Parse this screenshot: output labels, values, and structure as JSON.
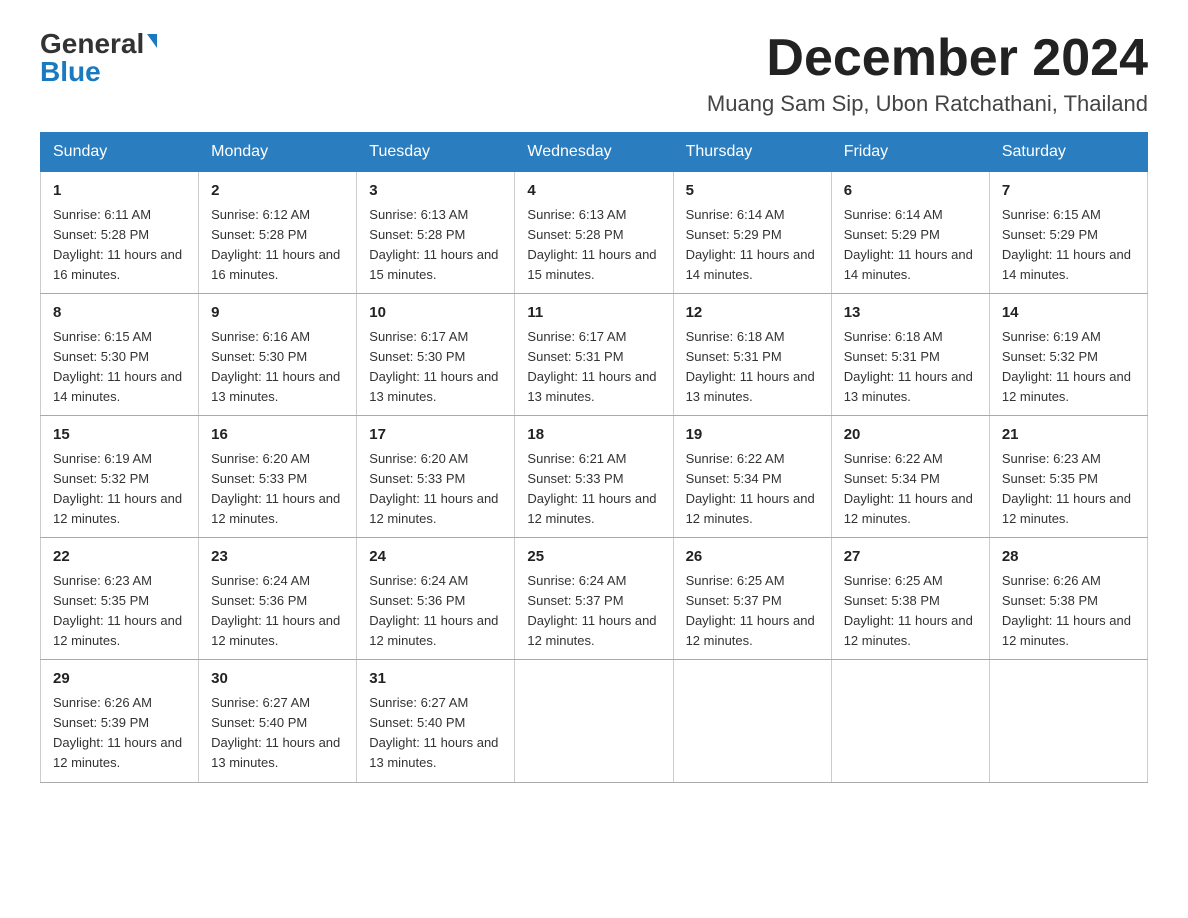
{
  "logo": {
    "general": "General",
    "blue": "Blue"
  },
  "title": "December 2024",
  "location": "Muang Sam Sip, Ubon Ratchathani, Thailand",
  "days_of_week": [
    "Sunday",
    "Monday",
    "Tuesday",
    "Wednesday",
    "Thursday",
    "Friday",
    "Saturday"
  ],
  "weeks": [
    [
      {
        "day": "1",
        "sunrise": "6:11 AM",
        "sunset": "5:28 PM",
        "daylight": "11 hours and 16 minutes."
      },
      {
        "day": "2",
        "sunrise": "6:12 AM",
        "sunset": "5:28 PM",
        "daylight": "11 hours and 16 minutes."
      },
      {
        "day": "3",
        "sunrise": "6:13 AM",
        "sunset": "5:28 PM",
        "daylight": "11 hours and 15 minutes."
      },
      {
        "day": "4",
        "sunrise": "6:13 AM",
        "sunset": "5:28 PM",
        "daylight": "11 hours and 15 minutes."
      },
      {
        "day": "5",
        "sunrise": "6:14 AM",
        "sunset": "5:29 PM",
        "daylight": "11 hours and 14 minutes."
      },
      {
        "day": "6",
        "sunrise": "6:14 AM",
        "sunset": "5:29 PM",
        "daylight": "11 hours and 14 minutes."
      },
      {
        "day": "7",
        "sunrise": "6:15 AM",
        "sunset": "5:29 PM",
        "daylight": "11 hours and 14 minutes."
      }
    ],
    [
      {
        "day": "8",
        "sunrise": "6:15 AM",
        "sunset": "5:30 PM",
        "daylight": "11 hours and 14 minutes."
      },
      {
        "day": "9",
        "sunrise": "6:16 AM",
        "sunset": "5:30 PM",
        "daylight": "11 hours and 13 minutes."
      },
      {
        "day": "10",
        "sunrise": "6:17 AM",
        "sunset": "5:30 PM",
        "daylight": "11 hours and 13 minutes."
      },
      {
        "day": "11",
        "sunrise": "6:17 AM",
        "sunset": "5:31 PM",
        "daylight": "11 hours and 13 minutes."
      },
      {
        "day": "12",
        "sunrise": "6:18 AM",
        "sunset": "5:31 PM",
        "daylight": "11 hours and 13 minutes."
      },
      {
        "day": "13",
        "sunrise": "6:18 AM",
        "sunset": "5:31 PM",
        "daylight": "11 hours and 13 minutes."
      },
      {
        "day": "14",
        "sunrise": "6:19 AM",
        "sunset": "5:32 PM",
        "daylight": "11 hours and 12 minutes."
      }
    ],
    [
      {
        "day": "15",
        "sunrise": "6:19 AM",
        "sunset": "5:32 PM",
        "daylight": "11 hours and 12 minutes."
      },
      {
        "day": "16",
        "sunrise": "6:20 AM",
        "sunset": "5:33 PM",
        "daylight": "11 hours and 12 minutes."
      },
      {
        "day": "17",
        "sunrise": "6:20 AM",
        "sunset": "5:33 PM",
        "daylight": "11 hours and 12 minutes."
      },
      {
        "day": "18",
        "sunrise": "6:21 AM",
        "sunset": "5:33 PM",
        "daylight": "11 hours and 12 minutes."
      },
      {
        "day": "19",
        "sunrise": "6:22 AM",
        "sunset": "5:34 PM",
        "daylight": "11 hours and 12 minutes."
      },
      {
        "day": "20",
        "sunrise": "6:22 AM",
        "sunset": "5:34 PM",
        "daylight": "11 hours and 12 minutes."
      },
      {
        "day": "21",
        "sunrise": "6:23 AM",
        "sunset": "5:35 PM",
        "daylight": "11 hours and 12 minutes."
      }
    ],
    [
      {
        "day": "22",
        "sunrise": "6:23 AM",
        "sunset": "5:35 PM",
        "daylight": "11 hours and 12 minutes."
      },
      {
        "day": "23",
        "sunrise": "6:24 AM",
        "sunset": "5:36 PM",
        "daylight": "11 hours and 12 minutes."
      },
      {
        "day": "24",
        "sunrise": "6:24 AM",
        "sunset": "5:36 PM",
        "daylight": "11 hours and 12 minutes."
      },
      {
        "day": "25",
        "sunrise": "6:24 AM",
        "sunset": "5:37 PM",
        "daylight": "11 hours and 12 minutes."
      },
      {
        "day": "26",
        "sunrise": "6:25 AM",
        "sunset": "5:37 PM",
        "daylight": "11 hours and 12 minutes."
      },
      {
        "day": "27",
        "sunrise": "6:25 AM",
        "sunset": "5:38 PM",
        "daylight": "11 hours and 12 minutes."
      },
      {
        "day": "28",
        "sunrise": "6:26 AM",
        "sunset": "5:38 PM",
        "daylight": "11 hours and 12 minutes."
      }
    ],
    [
      {
        "day": "29",
        "sunrise": "6:26 AM",
        "sunset": "5:39 PM",
        "daylight": "11 hours and 12 minutes."
      },
      {
        "day": "30",
        "sunrise": "6:27 AM",
        "sunset": "5:40 PM",
        "daylight": "11 hours and 13 minutes."
      },
      {
        "day": "31",
        "sunrise": "6:27 AM",
        "sunset": "5:40 PM",
        "daylight": "11 hours and 13 minutes."
      },
      null,
      null,
      null,
      null
    ]
  ]
}
